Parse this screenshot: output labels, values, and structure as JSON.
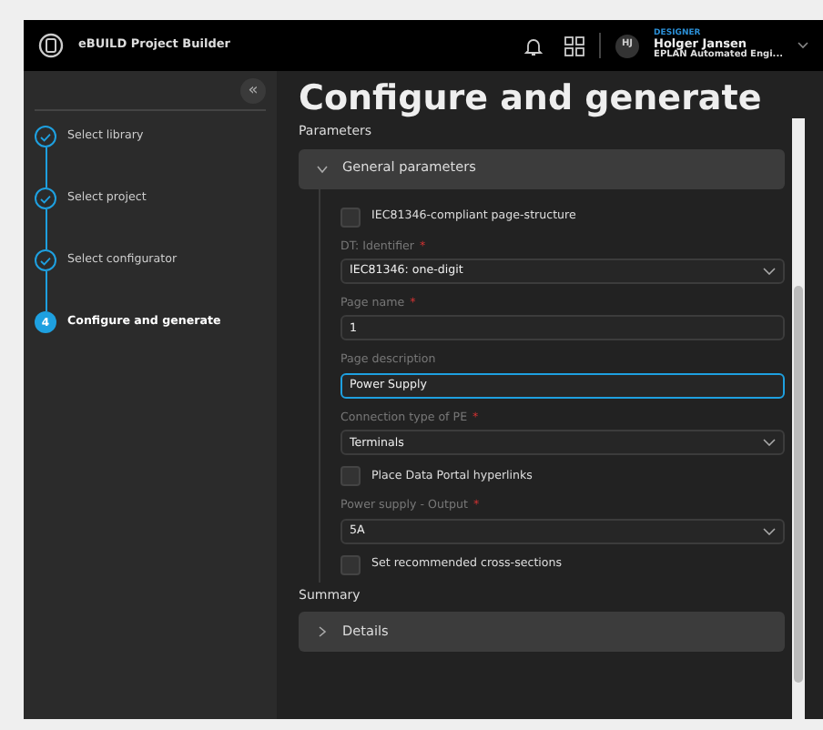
{
  "header": {
    "app_name": "eBUILD Project Builder",
    "avatar": "HJ",
    "role": "DESIGNER",
    "user_name": "Holger Jansen",
    "organization": "EPLAN Automated Engi..."
  },
  "sidebar": {
    "collapse": "«",
    "steps": [
      {
        "label": "Select library",
        "completed": true,
        "selected": false
      },
      {
        "label": "Select project",
        "completed": true,
        "selected": false
      },
      {
        "label": "Select configurator",
        "completed": true,
        "selected": false
      },
      {
        "label": "Configure and generate",
        "completed": false,
        "selected": true,
        "number": "4"
      }
    ]
  },
  "page_title": "Configure and generate",
  "sections": [
    {
      "heading": "Parameters",
      "panel": {
        "title": "General parameters",
        "expanded": true
      },
      "fields": [
        {
          "kind": "checkbox",
          "label": "IEC81346-compliant page-structure",
          "checked": false
        },
        {
          "kind": "select",
          "label": "DT: Identifier",
          "required_mark": "*",
          "value": "IEC81346: one-digit",
          "focused": false
        },
        {
          "kind": "input",
          "label": "Page name",
          "required_mark": "*",
          "value": "1",
          "focused": false
        },
        {
          "kind": "input",
          "label": "Page description",
          "value": "Power Supply",
          "focused": true
        },
        {
          "kind": "select",
          "label": "Connection type of PE",
          "required_mark": "*",
          "value": "Terminals",
          "focused": false
        },
        {
          "kind": "checkbox",
          "label": "Place Data Portal hyperlinks",
          "checked": false
        },
        {
          "kind": "select",
          "label": "Power supply - Output",
          "required_mark": "*",
          "value": "5A",
          "focused": false
        },
        {
          "kind": "checkbox",
          "label": "Set recommended cross-sections",
          "checked": false
        }
      ]
    },
    {
      "heading": "Summary",
      "panel": {
        "title": "Details",
        "expanded": false
      }
    }
  ]
}
